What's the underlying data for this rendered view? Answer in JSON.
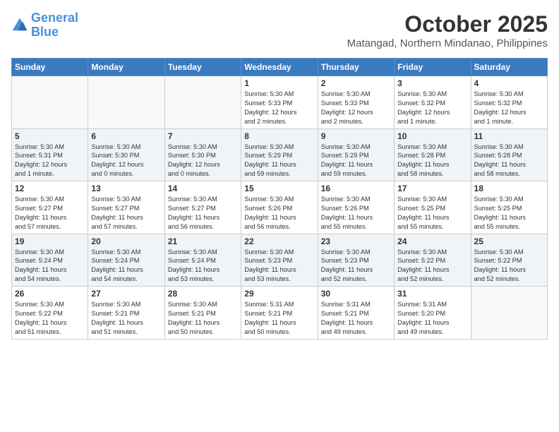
{
  "header": {
    "logo_line1": "General",
    "logo_line2": "Blue",
    "month": "October 2025",
    "location": "Matangad, Northern Mindanao, Philippines"
  },
  "days_of_week": [
    "Sunday",
    "Monday",
    "Tuesday",
    "Wednesday",
    "Thursday",
    "Friday",
    "Saturday"
  ],
  "weeks": [
    [
      {
        "day": "",
        "info": ""
      },
      {
        "day": "",
        "info": ""
      },
      {
        "day": "",
        "info": ""
      },
      {
        "day": "1",
        "info": "Sunrise: 5:30 AM\nSunset: 5:33 PM\nDaylight: 12 hours\nand 2 minutes."
      },
      {
        "day": "2",
        "info": "Sunrise: 5:30 AM\nSunset: 5:33 PM\nDaylight: 12 hours\nand 2 minutes."
      },
      {
        "day": "3",
        "info": "Sunrise: 5:30 AM\nSunset: 5:32 PM\nDaylight: 12 hours\nand 1 minute."
      },
      {
        "day": "4",
        "info": "Sunrise: 5:30 AM\nSunset: 5:32 PM\nDaylight: 12 hours\nand 1 minute."
      }
    ],
    [
      {
        "day": "5",
        "info": "Sunrise: 5:30 AM\nSunset: 5:31 PM\nDaylight: 12 hours\nand 1 minute."
      },
      {
        "day": "6",
        "info": "Sunrise: 5:30 AM\nSunset: 5:30 PM\nDaylight: 12 hours\nand 0 minutes."
      },
      {
        "day": "7",
        "info": "Sunrise: 5:30 AM\nSunset: 5:30 PM\nDaylight: 12 hours\nand 0 minutes."
      },
      {
        "day": "8",
        "info": "Sunrise: 5:30 AM\nSunset: 5:29 PM\nDaylight: 11 hours\nand 59 minutes."
      },
      {
        "day": "9",
        "info": "Sunrise: 5:30 AM\nSunset: 5:29 PM\nDaylight: 11 hours\nand 59 minutes."
      },
      {
        "day": "10",
        "info": "Sunrise: 5:30 AM\nSunset: 5:28 PM\nDaylight: 11 hours\nand 58 minutes."
      },
      {
        "day": "11",
        "info": "Sunrise: 5:30 AM\nSunset: 5:28 PM\nDaylight: 11 hours\nand 58 minutes."
      }
    ],
    [
      {
        "day": "12",
        "info": "Sunrise: 5:30 AM\nSunset: 5:27 PM\nDaylight: 11 hours\nand 57 minutes."
      },
      {
        "day": "13",
        "info": "Sunrise: 5:30 AM\nSunset: 5:27 PM\nDaylight: 11 hours\nand 57 minutes."
      },
      {
        "day": "14",
        "info": "Sunrise: 5:30 AM\nSunset: 5:27 PM\nDaylight: 11 hours\nand 56 minutes."
      },
      {
        "day": "15",
        "info": "Sunrise: 5:30 AM\nSunset: 5:26 PM\nDaylight: 11 hours\nand 56 minutes."
      },
      {
        "day": "16",
        "info": "Sunrise: 5:30 AM\nSunset: 5:26 PM\nDaylight: 11 hours\nand 55 minutes."
      },
      {
        "day": "17",
        "info": "Sunrise: 5:30 AM\nSunset: 5:25 PM\nDaylight: 11 hours\nand 55 minutes."
      },
      {
        "day": "18",
        "info": "Sunrise: 5:30 AM\nSunset: 5:25 PM\nDaylight: 11 hours\nand 55 minutes."
      }
    ],
    [
      {
        "day": "19",
        "info": "Sunrise: 5:30 AM\nSunset: 5:24 PM\nDaylight: 11 hours\nand 54 minutes."
      },
      {
        "day": "20",
        "info": "Sunrise: 5:30 AM\nSunset: 5:24 PM\nDaylight: 11 hours\nand 54 minutes."
      },
      {
        "day": "21",
        "info": "Sunrise: 5:30 AM\nSunset: 5:24 PM\nDaylight: 11 hours\nand 53 minutes."
      },
      {
        "day": "22",
        "info": "Sunrise: 5:30 AM\nSunset: 5:23 PM\nDaylight: 11 hours\nand 53 minutes."
      },
      {
        "day": "23",
        "info": "Sunrise: 5:30 AM\nSunset: 5:23 PM\nDaylight: 11 hours\nand 52 minutes."
      },
      {
        "day": "24",
        "info": "Sunrise: 5:30 AM\nSunset: 5:22 PM\nDaylight: 11 hours\nand 52 minutes."
      },
      {
        "day": "25",
        "info": "Sunrise: 5:30 AM\nSunset: 5:22 PM\nDaylight: 11 hours\nand 52 minutes."
      }
    ],
    [
      {
        "day": "26",
        "info": "Sunrise: 5:30 AM\nSunset: 5:22 PM\nDaylight: 11 hours\nand 51 minutes."
      },
      {
        "day": "27",
        "info": "Sunrise: 5:30 AM\nSunset: 5:21 PM\nDaylight: 11 hours\nand 51 minutes."
      },
      {
        "day": "28",
        "info": "Sunrise: 5:30 AM\nSunset: 5:21 PM\nDaylight: 11 hours\nand 50 minutes."
      },
      {
        "day": "29",
        "info": "Sunrise: 5:31 AM\nSunset: 5:21 PM\nDaylight: 11 hours\nand 50 minutes."
      },
      {
        "day": "30",
        "info": "Sunrise: 5:31 AM\nSunset: 5:21 PM\nDaylight: 11 hours\nand 49 minutes."
      },
      {
        "day": "31",
        "info": "Sunrise: 5:31 AM\nSunset: 5:20 PM\nDaylight: 11 hours\nand 49 minutes."
      },
      {
        "day": "",
        "info": ""
      }
    ]
  ]
}
